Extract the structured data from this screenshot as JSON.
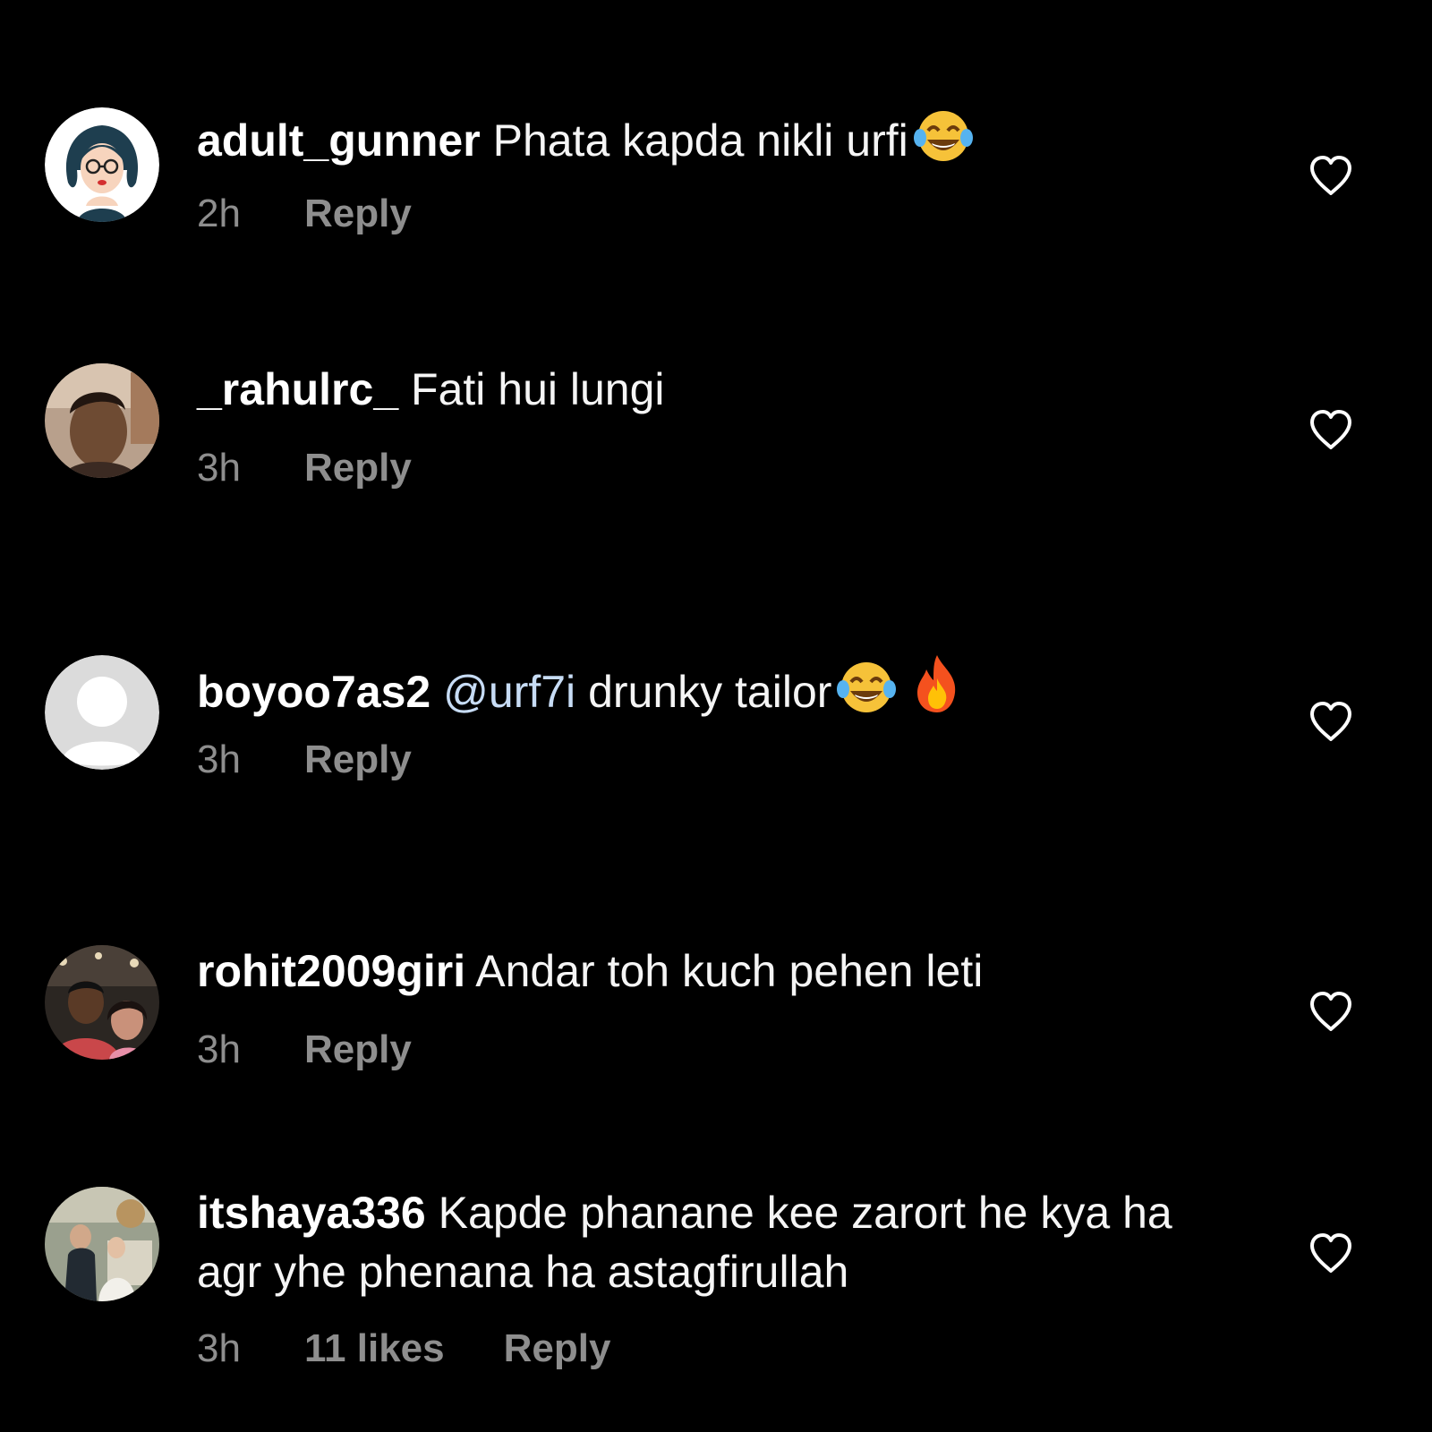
{
  "comments": [
    {
      "username": "adult_gunner",
      "text": "Phata kapda nikli urfi",
      "emojis": [
        "face-with-tears-of-joy"
      ],
      "time": "2h",
      "reply_label": "Reply",
      "avatar": "cartoon-woman-glasses"
    },
    {
      "username": "_rahulrc_",
      "text": "Fati hui lungi",
      "emojis": [],
      "time": "3h",
      "reply_label": "Reply",
      "avatar": "man-photo"
    },
    {
      "username": "boyoo7as2",
      "mention": "@urf7i",
      "text": "drunky tailor",
      "emojis": [
        "face-with-tears-of-joy",
        "fire"
      ],
      "time": "3h",
      "reply_label": "Reply",
      "avatar": "default-placeholder"
    },
    {
      "username": "rohit2009giri",
      "text": "Andar toh kuch pehen leti",
      "emojis": [],
      "time": "3h",
      "reply_label": "Reply",
      "avatar": "couple-photo"
    },
    {
      "username": "itshaya336",
      "text": "Kapde phanane kee zarort he kya ha agr yhe phenana ha astagfirullah",
      "emojis": [],
      "time": "3h",
      "likes": "11 likes",
      "reply_label": "Reply",
      "avatar": "wedding-photo"
    }
  ],
  "colors": {
    "background": "#000000",
    "text": "#f5f5f5",
    "meta": "#8e8e8e",
    "mention": "#c7dcf5"
  }
}
